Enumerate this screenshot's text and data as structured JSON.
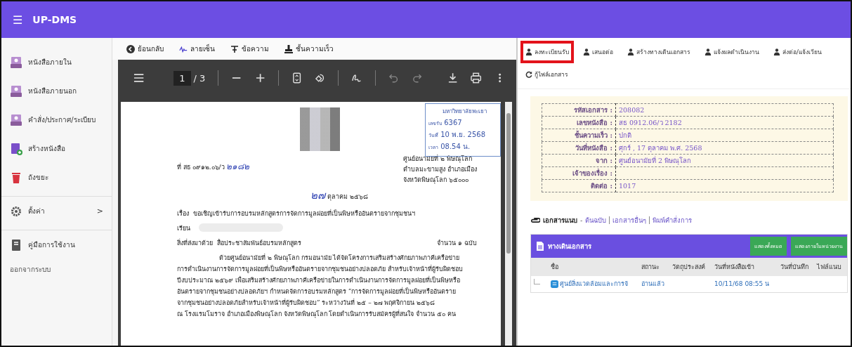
{
  "app": {
    "title": "UP-DMS",
    "menu_icon": "☰"
  },
  "sidebar": {
    "items": [
      {
        "kind": "nav",
        "label": "หนังสือภายใน"
      },
      {
        "kind": "nav",
        "label": "หนังสือภายนอก"
      },
      {
        "kind": "nav",
        "label": "คำสั่ง/ประกาศ/ระเบียบ"
      },
      {
        "kind": "nav",
        "label": "สร้างหนังสือ"
      },
      {
        "kind": "nav",
        "label": "ถังขยะ"
      },
      {
        "kind": "expand",
        "label": "ตั้งค่า",
        "chevron": ">"
      },
      {
        "kind": "nav",
        "label": "คู่มือการใช้งาน"
      },
      {
        "kind": "plain",
        "label": "ออกจากระบบ"
      }
    ]
  },
  "doc_toolbar": [
    {
      "label": "ย้อนกลับ"
    },
    {
      "label": "ลายเซ็น"
    },
    {
      "label": "ข้อความ"
    },
    {
      "label": "ชั้นความเร็ว"
    }
  ],
  "pdf_viewer": {
    "page": "1",
    "total": "/ 3",
    "document": {
      "stamp": {
        "org": "มหาวิทยาลัยพะเยา",
        "number_label": "เลขรับ",
        "number": "6367",
        "date_label": "วันที่",
        "date": "10 พ.ย. 2568",
        "time_label": "เวลา",
        "time": "08.54 น."
      },
      "ref_prefix": "ที่ สธ ๐๙๑๒.๐๖/ว",
      "ref_handwritten": "๒๑๘๒",
      "address": [
        "ศูนย์อนามัยที่ ๒ พิษณุโลก",
        "ตำบลมะขามสูง อำเภอเมือง",
        "จังหวัดพิษณุโลก ๖๕๐๐๐"
      ],
      "date_handwritten": "๒๗",
      "date_rest": "ตุลาคม ๒๕๖๘",
      "subject_label": "เรื่อง",
      "subject": "ขอเชิญเข้ารับการอบรมหลักสูตรการจัดการมูลฝอยที่เป็นพิษหรืออันตรายจากชุมชนฯ",
      "to_label": "เรียน",
      "enclosure_label": "สิ่งที่ส่งมาด้วย",
      "enclosure": "สื่อประชาสัมพันธ์อบรมหลักสูตร",
      "enclosure_count": "จำนวน ๑ ฉบับ",
      "body": [
        "ด้วยศูนย์อนามัยที่ ๒ พิษณุโลก กรมอนามัย ได้จัดโครงการเสริมสร้างศักยภาพภาคีเครือข่าย",
        "การดำเนินงานการจัดการมูลฝอยที่เป็นพิษหรืออันตรายจากชุมชนอย่างปลอดภัย สำหรับเจ้าหน้าที่ผู้รับผิดชอบ",
        "ปีงบประมาณ ๒๕๖๙ เพื่อเสริมสร้างศักยภาพภาคีเครือข่ายในการดำเนินงานการจัดการมูลฝอยที่เป็นพิษหรือ",
        "อันตรายจากชุมชนอย่างปลอดภัยฯ กำหนดจัดการอบรมหลักสูตร “การจัดการมูลฝอยที่เป็นพิษหรืออันตราย",
        "จากชุมชนอย่างปลอดภัยสำหรับเจ้าหน้าที่ผู้รับผิดชอบ” ระหว่างวันที่ ๒๕ – ๒๗ พฤศจิกายน ๒๕๖๘",
        "ณ โรงแรมโมราจ อำเภอเมืองพิษณุโลก จังหวัดพิษณุโลก โดยดำเนินการรับสมัครผู้ที่สนใจ จำนวน ๕๐ คน"
      ]
    }
  },
  "actions": [
    {
      "label": "ลงทะเบียนรับ",
      "kind": "person",
      "highlighted": true
    },
    {
      "label": "เสนอต่อ",
      "kind": "person",
      "highlighted": false
    },
    {
      "label": "สร้างทางเดินเอกสาร",
      "kind": "person",
      "highlighted": false
    },
    {
      "label": "แจ้งผลดำเนินงาน",
      "kind": "person",
      "highlighted": false
    },
    {
      "label": "ส่งต่อ/แจ้งเวียน",
      "kind": "person",
      "highlighted": false
    },
    {
      "label": "กู้ไฟล์เอกสาร",
      "kind": "refresh",
      "highlighted": false
    }
  ],
  "info": [
    {
      "label": "รหัสเอกสาร :",
      "value": "208082"
    },
    {
      "label": "เลขหนังสือ :",
      "value": "สธ 0912.06/ว 2182"
    },
    {
      "label": "ชั้นความเร็ว :",
      "value": "ปกติ"
    },
    {
      "label": "วันที่หนังสือ :",
      "value": "ศุกร์ , 17 ตุลาคม พ.ศ. 2568"
    },
    {
      "label": "จาก :",
      "value": "ศูนย์อนามัยที่ 2 พิษณุโลก"
    },
    {
      "label": "เจ้าของเรื่อง :"
    },
    {
      "label": "ติดต่อ :",
      "value": "1017"
    }
  ],
  "attachments": {
    "label": "เอกสารแนบ",
    "dash": "-",
    "links": [
      "ต้นฉบับ",
      "เอกสารอื่นๆ",
      "พิมพ์คำสั่งการ"
    ]
  },
  "routing": {
    "title": "ทางเดินเอกสาร",
    "buttons": [
      "แสดงทั้งหมด",
      "แสดงภายในหน่วยงาน"
    ],
    "columns": [
      "ชื่อ",
      "สถานะ",
      "วัตถุประสงค์",
      "วันที่หนังสือเข้า",
      "วันที่บันทึก",
      "ไฟล์แนบ"
    ],
    "rows": [
      {
        "name": "ศูนย์สิ่งแวดล้อมและการจั",
        "status": "อ่านแล้ว",
        "received": "10/11/68 08:55 น"
      }
    ]
  }
}
